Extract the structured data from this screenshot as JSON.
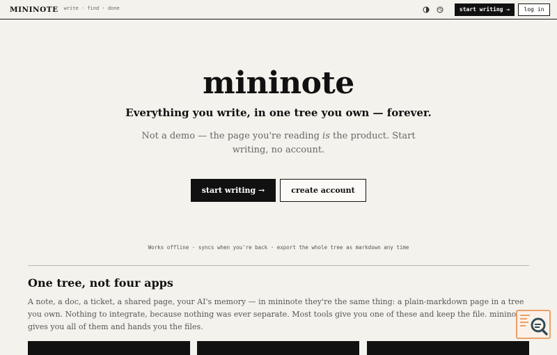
{
  "header": {
    "brand": "MININOTE",
    "tagline": "write · find · done",
    "icons": {
      "theme": "contrast-icon",
      "theme2": "palette-icon"
    },
    "start_writing": "start writing →",
    "log_in": "log in"
  },
  "hero": {
    "title": "mininote",
    "subtitle": "Everything you write, in one tree you own — forever.",
    "desc_part1": "Not a demo — the page you're reading ",
    "desc_em": "is",
    "desc_part2": " the product. Start writing, no account.",
    "cta_primary": "start writing →",
    "cta_secondary": "create account"
  },
  "features_line": "Works offline · syncs when you're back · export the whole tree as markdown any time",
  "section": {
    "title": "One tree, not four apps",
    "body": "A note, a doc, a ticket, a shared page, your AI's memory — in mininote they're the same thing: a plain-markdown page in a tree you own. Nothing to integrate, because nothing was ever separate. Most tools give you one of these and keep the file. mininote gives you all of them and hands you the files."
  },
  "colors": {
    "background": "#f4f2ec",
    "ink": "#111111",
    "muted": "#666666",
    "widget_accent": "#e9a06a"
  }
}
